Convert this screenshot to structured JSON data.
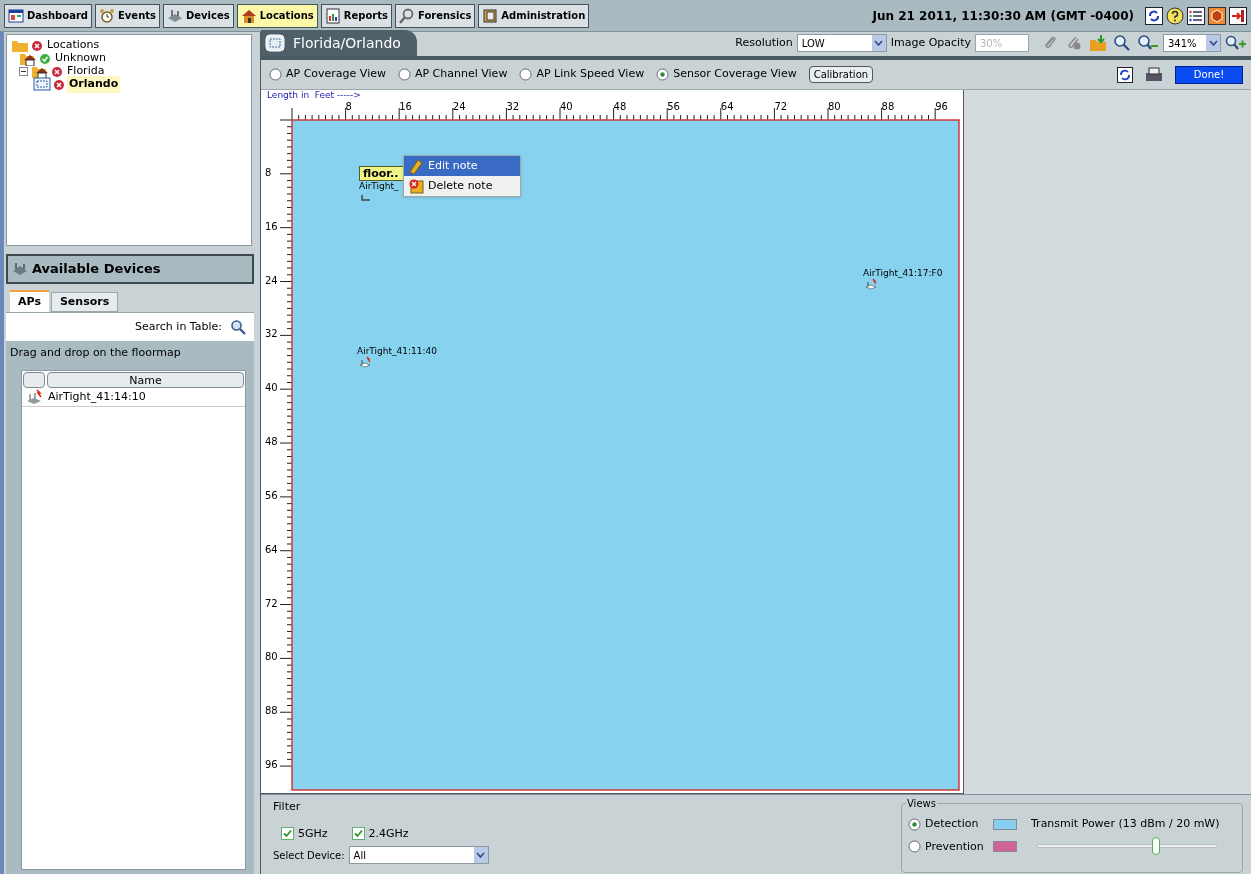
{
  "nav_tabs": [
    {
      "label": "Dashboard",
      "selected": false
    },
    {
      "label": "Events",
      "selected": false
    },
    {
      "label": "Devices",
      "selected": false
    },
    {
      "label": "Locations",
      "selected": true
    },
    {
      "label": "Reports",
      "selected": false
    },
    {
      "label": "Forensics",
      "selected": false
    },
    {
      "label": "Administration",
      "selected": false
    }
  ],
  "datetime": "Jun 21 2011, 11:30:30 AM (GMT -0400)",
  "location_tree": [
    {
      "label": "Locations",
      "ok": false,
      "selected": false,
      "children": [
        {
          "label": "Unknown",
          "ok": true,
          "selected": false
        },
        {
          "label": "Florida",
          "ok": false,
          "selected": false,
          "expanded": true,
          "children": [
            {
              "label": "Orlando",
              "ok": false,
              "selected": true
            }
          ]
        }
      ]
    }
  ],
  "available_devices": {
    "title": "Available Devices",
    "tabs": [
      {
        "label": "APs",
        "selected": true
      },
      {
        "label": "Sensors",
        "selected": false
      }
    ],
    "search_label": "Search in Table:",
    "hint": "Drag and drop on the floormap",
    "columns": [
      "Name"
    ],
    "rows": [
      "AirTight_41:14:10"
    ]
  },
  "floor_tab": "Florida/Orlando",
  "toolbar": {
    "resolution_label": "Resolution",
    "resolution": "LOW",
    "opacity_label": "Image Opacity",
    "opacity": "30%",
    "zoom": "341%"
  },
  "views": [
    {
      "label": "AP Coverage View",
      "selected": false
    },
    {
      "label": "AP Channel View",
      "selected": false
    },
    {
      "label": "AP Link Speed View",
      "selected": false
    },
    {
      "label": "Sensor Coverage View",
      "selected": true
    }
  ],
  "calibration_button": "Calibration",
  "done_button": "Done!",
  "ruler": {
    "caption": "Length in  Feet ----->",
    "x_labels": [
      "8",
      "16",
      "24",
      "32",
      "40",
      "48",
      "56",
      "64",
      "72",
      "80",
      "88",
      "96"
    ],
    "y_labels": [
      "8",
      "16",
      "24",
      "32",
      "40",
      "48",
      "56",
      "64",
      "72",
      "80",
      "88",
      "96"
    ]
  },
  "map_devices": [
    {
      "label": "AirTight_",
      "note": "floor.."
    },
    {
      "label": "AirTight_41:17:F0"
    },
    {
      "label": "AirTight_41:11:40"
    }
  ],
  "context_menu": [
    {
      "label": "Edit note",
      "selected": true
    },
    {
      "label": "Delete note",
      "selected": false
    }
  ],
  "filter": {
    "title": "Filter",
    "bands": [
      {
        "label": "5GHz",
        "checked": true
      },
      {
        "label": "2.4GHz",
        "checked": true
      }
    ],
    "device_label": "Select Device:",
    "device": "All"
  },
  "views_panel": {
    "title": "Views",
    "modes": [
      {
        "label": "Detection",
        "selected": true,
        "color": "#87cfee"
      },
      {
        "label": "Prevention",
        "selected": false,
        "color": "#d06498"
      }
    ],
    "power_label": "Transmit Power  (13 dBm /  20 mW)",
    "level": 0.66
  }
}
